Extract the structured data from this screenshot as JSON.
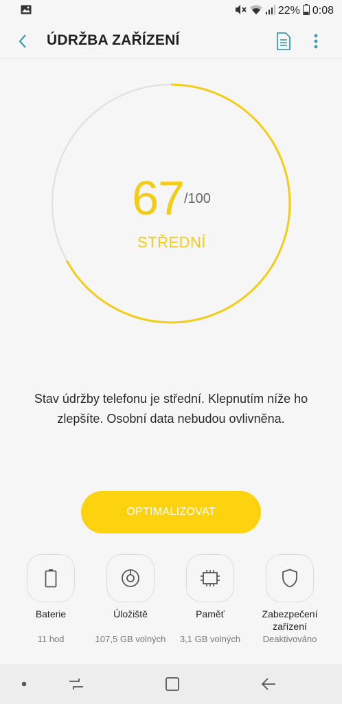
{
  "status_bar": {
    "battery_percent": "22%",
    "time": "0:08"
  },
  "header": {
    "title": "ÚDRŽBA ZAŘÍZENÍ"
  },
  "score": {
    "value": "67",
    "max": "/100",
    "status": "STŘEDNÍ",
    "fraction": 0.67,
    "accent_color": "#f5cc14"
  },
  "description": "Stav údržby telefonu je střední. Klepnutím níže ho zlepšíte. Osobní data nebudou ovlivněna.",
  "optimize_button": {
    "label": "OPTIMALIZOVAT",
    "color": "#fdd20e"
  },
  "tiles": [
    {
      "icon": "battery-icon",
      "label": "Baterie",
      "sub": "11 hod"
    },
    {
      "icon": "storage-icon",
      "label": "Úložiště",
      "sub": "107,5 GB volných"
    },
    {
      "icon": "memory-chip-icon",
      "label": "Paměť",
      "sub": "3,1 GB volných"
    },
    {
      "icon": "shield-icon",
      "label": "Zabezpečení zařízení",
      "sub": "Deaktivováno"
    }
  ]
}
